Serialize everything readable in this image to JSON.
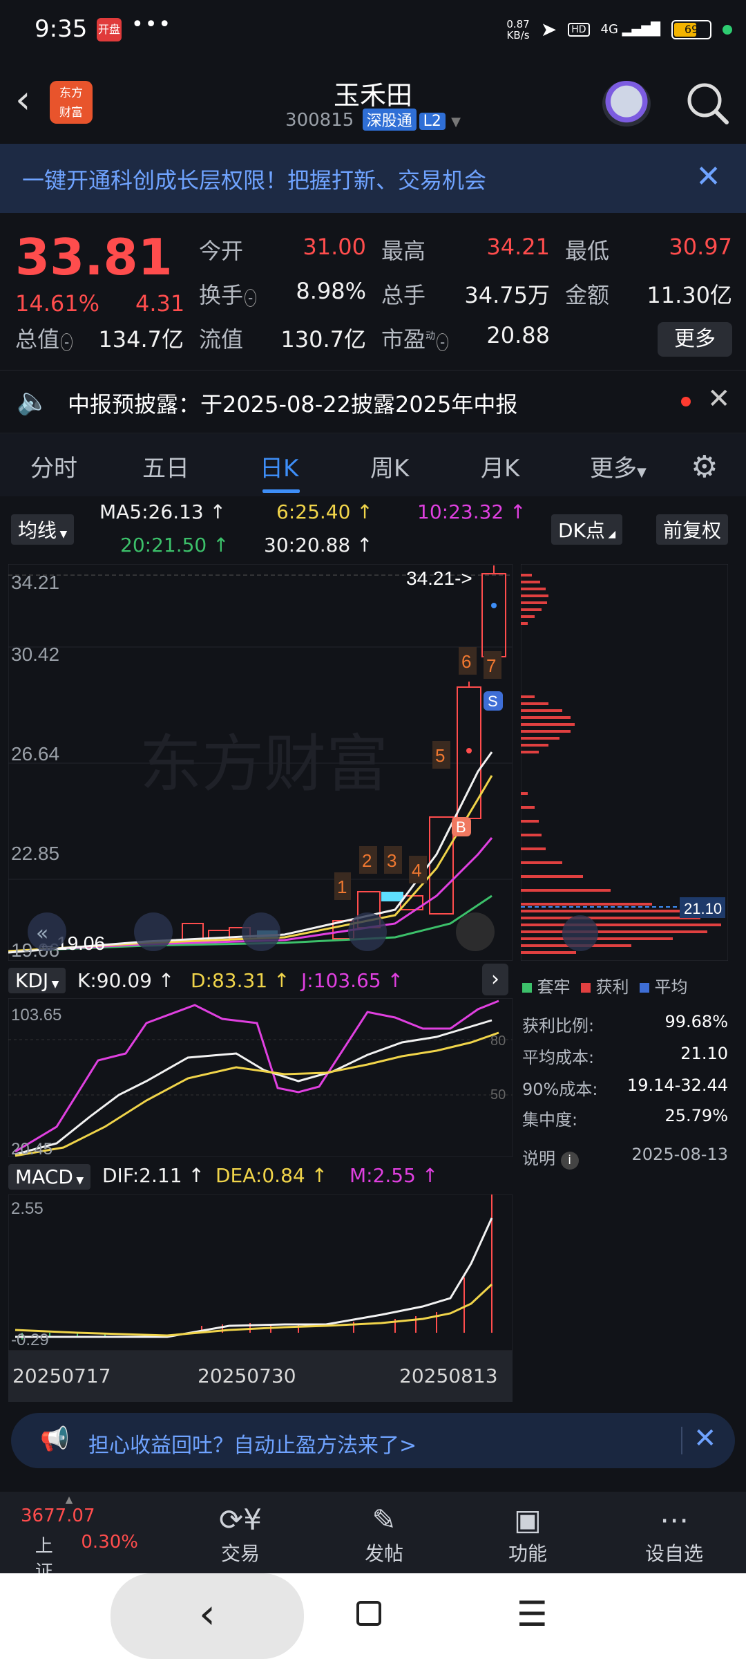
{
  "status_bar": {
    "time": "9:35",
    "badge": "开盘",
    "dots": "•••",
    "net_speed_value": "0.87",
    "net_speed_unit": "KB/s",
    "signal": "4G",
    "battery": "69"
  },
  "header": {
    "title": "玉禾田",
    "code": "300815",
    "tag_connect": "深股通",
    "tag_level": "L2",
    "logo_text_1": "东方",
    "logo_text_2": "财富"
  },
  "banner": {
    "text": "一键开通科创成长层权限！把握打新、交易机会"
  },
  "quote": {
    "price": "33.81",
    "change_pct": "14.61%",
    "change": "4.31",
    "stats": [
      {
        "label": "今开",
        "value": "31.00"
      },
      {
        "label": "最高",
        "value": "34.21"
      },
      {
        "label": "最低",
        "value": "30.97"
      },
      {
        "label": "换手",
        "value": "8.98%"
      },
      {
        "label": "总手",
        "value": "34.75万"
      },
      {
        "label": "金额",
        "value": "11.30亿"
      },
      {
        "label": "总值",
        "value": "134.7亿"
      },
      {
        "label": "流值",
        "value": "130.7亿"
      },
      {
        "label": "市盈",
        "value": "20.88"
      }
    ],
    "pe_sup": "动",
    "more_label": "更多"
  },
  "notice": {
    "text": "中报预披露：于2025-08-22披露2025年中报"
  },
  "tabs": [
    "分时",
    "五日",
    "日K",
    "周K",
    "月K",
    "更多"
  ],
  "indicators": {
    "ma_select": "均线",
    "ma5": "MA5:26.13",
    "ma6": "6:25.40",
    "ma10": "10:23.32",
    "ma20": "20:21.50",
    "ma30": "30:20.88",
    "dk_label": "DK点",
    "fq_label": "前复权",
    "arrow": "↑"
  },
  "kline": {
    "y_labels": [
      "34.21",
      "30.42",
      "26.64",
      "22.85",
      "19.06"
    ],
    "high_marker": "34.21->",
    "low_marker": "←19.06",
    "watermark": "东方财富",
    "signal_nums": [
      "1",
      "2",
      "3",
      "4",
      "5",
      "6",
      "7"
    ],
    "buy_tag": "B",
    "sell_tag": "S"
  },
  "kdj": {
    "select": "KDJ",
    "k": "K:90.09",
    "d": "D:83.31",
    "j": "J:103.65",
    "y_top": "103.65",
    "y_bottom": "20.45",
    "ref_80": "80",
    "ref_50": "50"
  },
  "macd": {
    "select": "MACD",
    "dif": "DIF:2.11",
    "dea": "DEA:0.84",
    "m": "M:2.55",
    "y_top": "2.55",
    "y_bottom": "-0.29",
    "dates": [
      "20250717",
      "20250730",
      "20250813"
    ]
  },
  "chip": {
    "price_tag": "21.10",
    "legend": [
      "套牢",
      "获利",
      "平均"
    ],
    "rows": [
      {
        "label": "获利比例:",
        "value": "99.68%"
      },
      {
        "label": "平均成本:",
        "value": "21.10"
      },
      {
        "label": "90%成本:",
        "value": "19.14-32.44"
      },
      {
        "label": "集中度:",
        "value": "25.79%"
      }
    ],
    "note_label": "说明",
    "date": "2025-08-13"
  },
  "promo": {
    "text": "担心收益回吐？自动止盈方法来了>"
  },
  "bottom_nav": {
    "index_value": "3677.07",
    "index_name": "上证",
    "index_pct": "0.30%",
    "items": [
      "交易",
      "发帖",
      "功能",
      "设自选"
    ]
  }
}
